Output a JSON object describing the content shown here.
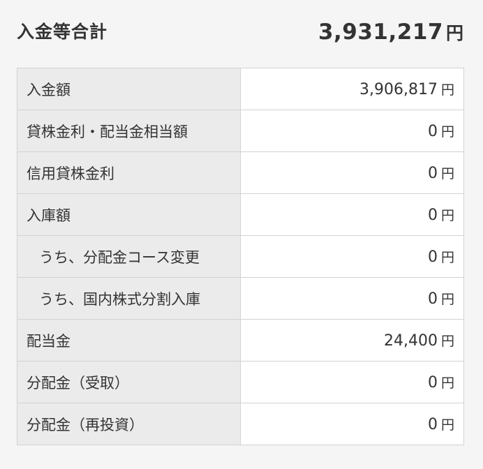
{
  "summary": {
    "title": "入金等合計",
    "total": "3,931,217",
    "unit": "円"
  },
  "rows": [
    {
      "label": "入金額",
      "value": "3,906,817",
      "unit": "円"
    },
    {
      "label": "貸株金利・配当金相当額",
      "value": "0",
      "unit": "円"
    },
    {
      "label": "信用貸株金利",
      "value": "0",
      "unit": "円"
    },
    {
      "label": "入庫額",
      "value": "0",
      "unit": "円"
    },
    {
      "label": "うち、分配金コース変更",
      "value": "0",
      "unit": "円"
    },
    {
      "label": "うち、国内株式分割入庫",
      "value": "0",
      "unit": "円"
    },
    {
      "label": "配当金",
      "value": "24,400",
      "unit": "円"
    },
    {
      "label": "分配金（受取）",
      "value": "0",
      "unit": "円"
    },
    {
      "label": "分配金（再投資）",
      "value": "0",
      "unit": "円"
    }
  ]
}
